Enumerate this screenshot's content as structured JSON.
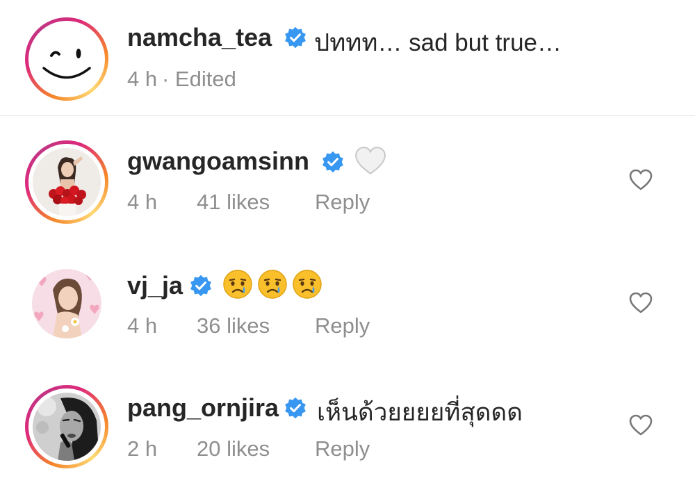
{
  "comments": [
    {
      "username": "namcha_tea",
      "verified": true,
      "text": "ปททท… sad but true…",
      "time": "4 h",
      "edited": "· Edited",
      "avatar": "smiley-face-icon"
    },
    {
      "username": "gwangoamsinn",
      "verified": true,
      "text": "",
      "emoji": "white-heart-emoji",
      "time": "4 h",
      "likes": "41 likes",
      "reply": "Reply"
    },
    {
      "username": "vj_ja",
      "verified": true,
      "text": "",
      "emoji": "crying-face-emoji",
      "time": "4 h",
      "likes": "36 likes",
      "reply": "Reply"
    },
    {
      "username": "pang_ornjira",
      "verified": true,
      "text": "เห็นด้วยยยยที่สุดดด",
      "time": "2 h",
      "likes": "20 likes",
      "reply": "Reply"
    }
  ],
  "colors": {
    "verified_blue": "#3897f0",
    "meta_gray": "#8e8e8e",
    "text": "#262626"
  }
}
